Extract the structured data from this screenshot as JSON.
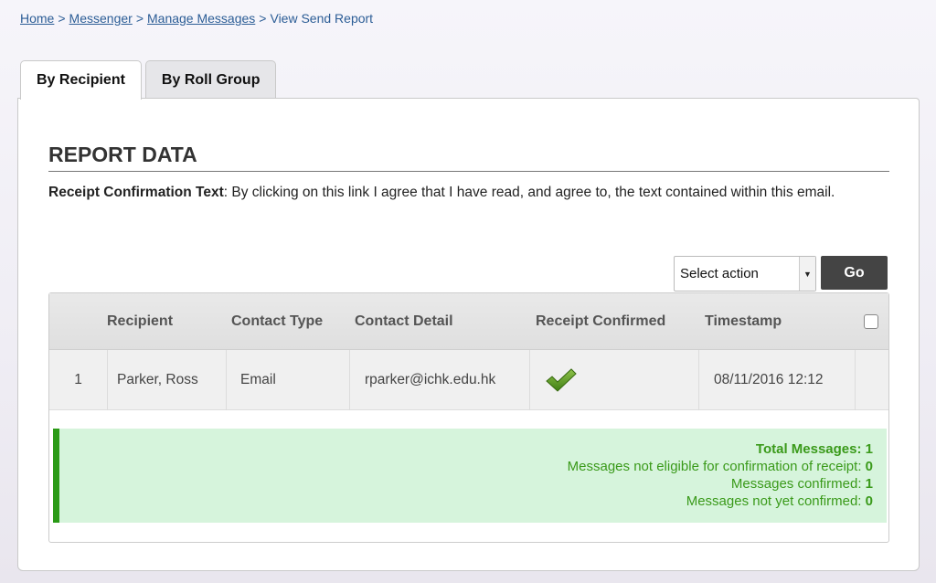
{
  "breadcrumb": {
    "items": [
      {
        "label": "Home"
      },
      {
        "label": "Messenger"
      },
      {
        "label": "Manage Messages"
      }
    ],
    "separator": ">",
    "current": "View Send Report"
  },
  "tabs": [
    {
      "label": "By Recipient",
      "active": true
    },
    {
      "label": "By Roll Group",
      "active": false
    }
  ],
  "report": {
    "title": "REPORT DATA",
    "receipt_label": "Receipt Confirmation Text",
    "receipt_text": ": By clicking on this link I agree that I have read, and agree to, the text contained within this email."
  },
  "actions": {
    "select_value": "Select action",
    "go_label": "Go"
  },
  "table": {
    "columns": [
      "Recipient",
      "Contact Type",
      "Contact Detail",
      "Receipt Confirmed",
      "Timestamp"
    ],
    "rows": [
      {
        "index": "1",
        "recipient": "Parker, Ross",
        "contact_type": "Email",
        "contact_detail": "rparker@ichk.edu.hk",
        "receipt_confirmed_icon": "checkmark-icon",
        "timestamp": "08/11/2016 12:12"
      }
    ]
  },
  "summary": {
    "total_label": "Total Messages:",
    "total_value": "1",
    "not_eligible_label": "Messages not eligible for confirmation of receipt:",
    "not_eligible_value": "0",
    "confirmed_label": "Messages confirmed:",
    "confirmed_value": "1",
    "not_confirmed_label": "Messages not yet confirmed:",
    "not_confirmed_value": "0"
  },
  "colors": {
    "link": "#2c5d96",
    "success_green": "#3a9a1a",
    "success_bg": "#d6f4dc",
    "go_button": "#444444"
  }
}
